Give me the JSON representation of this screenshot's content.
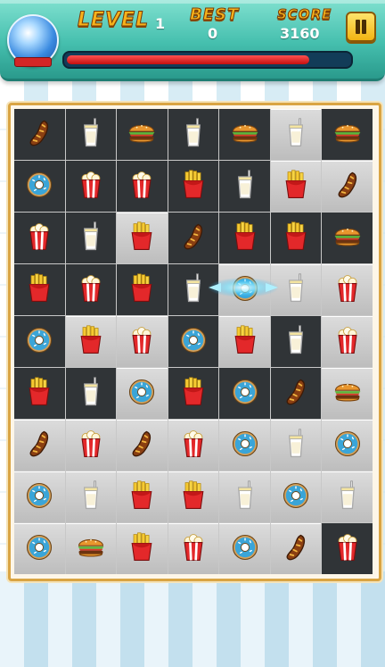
{
  "hud": {
    "level_label": "LEVEL",
    "level_value": "1",
    "best_label": "BEST",
    "best_value": "0",
    "score_label": "SCORE",
    "score_value": "3160",
    "progress_fraction": 0.86,
    "pause_icon": "pause-icon",
    "orb_icon": "crystal-orb-icon"
  },
  "board": {
    "selected_cell": {
      "row": 3,
      "col": 4
    },
    "rows": [
      [
        [
          "sausage",
          "dark"
        ],
        [
          "milk",
          "dark"
        ],
        [
          "burger",
          "dark"
        ],
        [
          "milk",
          "dark"
        ],
        [
          "burger",
          "dark"
        ],
        [
          "milk",
          "light"
        ],
        [
          "burger",
          "dark"
        ]
      ],
      [
        [
          "donut",
          "dark"
        ],
        [
          "popcorn",
          "dark"
        ],
        [
          "popcorn",
          "dark"
        ],
        [
          "fries",
          "dark"
        ],
        [
          "milk",
          "dark"
        ],
        [
          "fries",
          "light"
        ],
        [
          "sausage",
          "light"
        ]
      ],
      [
        [
          "popcorn",
          "dark"
        ],
        [
          "milk",
          "dark"
        ],
        [
          "fries",
          "light"
        ],
        [
          "sausage",
          "dark"
        ],
        [
          "fries",
          "dark"
        ],
        [
          "fries",
          "dark"
        ],
        [
          "burger",
          "dark"
        ]
      ],
      [
        [
          "fries",
          "dark"
        ],
        [
          "popcorn",
          "dark"
        ],
        [
          "fries",
          "dark"
        ],
        [
          "milk",
          "dark"
        ],
        [
          "donut",
          "light"
        ],
        [
          "milk",
          "light"
        ],
        [
          "popcorn",
          "light"
        ]
      ],
      [
        [
          "donut",
          "dark"
        ],
        [
          "fries",
          "light"
        ],
        [
          "popcorn",
          "light"
        ],
        [
          "donut",
          "dark"
        ],
        [
          "fries",
          "light"
        ],
        [
          "milk",
          "dark"
        ],
        [
          "popcorn",
          "light"
        ]
      ],
      [
        [
          "fries",
          "dark"
        ],
        [
          "milk",
          "dark"
        ],
        [
          "donut",
          "light"
        ],
        [
          "fries",
          "dark"
        ],
        [
          "donut",
          "dark"
        ],
        [
          "sausage",
          "dark"
        ],
        [
          "burger",
          "light"
        ]
      ],
      [
        [
          "sausage",
          "light"
        ],
        [
          "popcorn",
          "light"
        ],
        [
          "sausage",
          "light"
        ],
        [
          "popcorn",
          "light"
        ],
        [
          "donut",
          "light"
        ],
        [
          "milk",
          "light"
        ],
        [
          "donut",
          "light"
        ]
      ],
      [
        [
          "donut",
          "light"
        ],
        [
          "milk",
          "light"
        ],
        [
          "fries",
          "light"
        ],
        [
          "fries",
          "light"
        ],
        [
          "milk",
          "light"
        ],
        [
          "donut",
          "light"
        ],
        [
          "milk",
          "light"
        ]
      ],
      [
        [
          "donut",
          "light"
        ],
        [
          "burger",
          "light"
        ],
        [
          "fries",
          "light"
        ],
        [
          "popcorn",
          "light"
        ],
        [
          "donut",
          "light"
        ],
        [
          "sausage",
          "light"
        ],
        [
          "popcorn",
          "dark"
        ]
      ]
    ]
  },
  "colors": {
    "hud_top": "#7fe0cf",
    "label_gold": "#f7b21b",
    "progress_red": "#c40f0f",
    "board_border": "#d9a443",
    "cell_dark": "#303437",
    "cell_light": "#cfcfcf"
  }
}
